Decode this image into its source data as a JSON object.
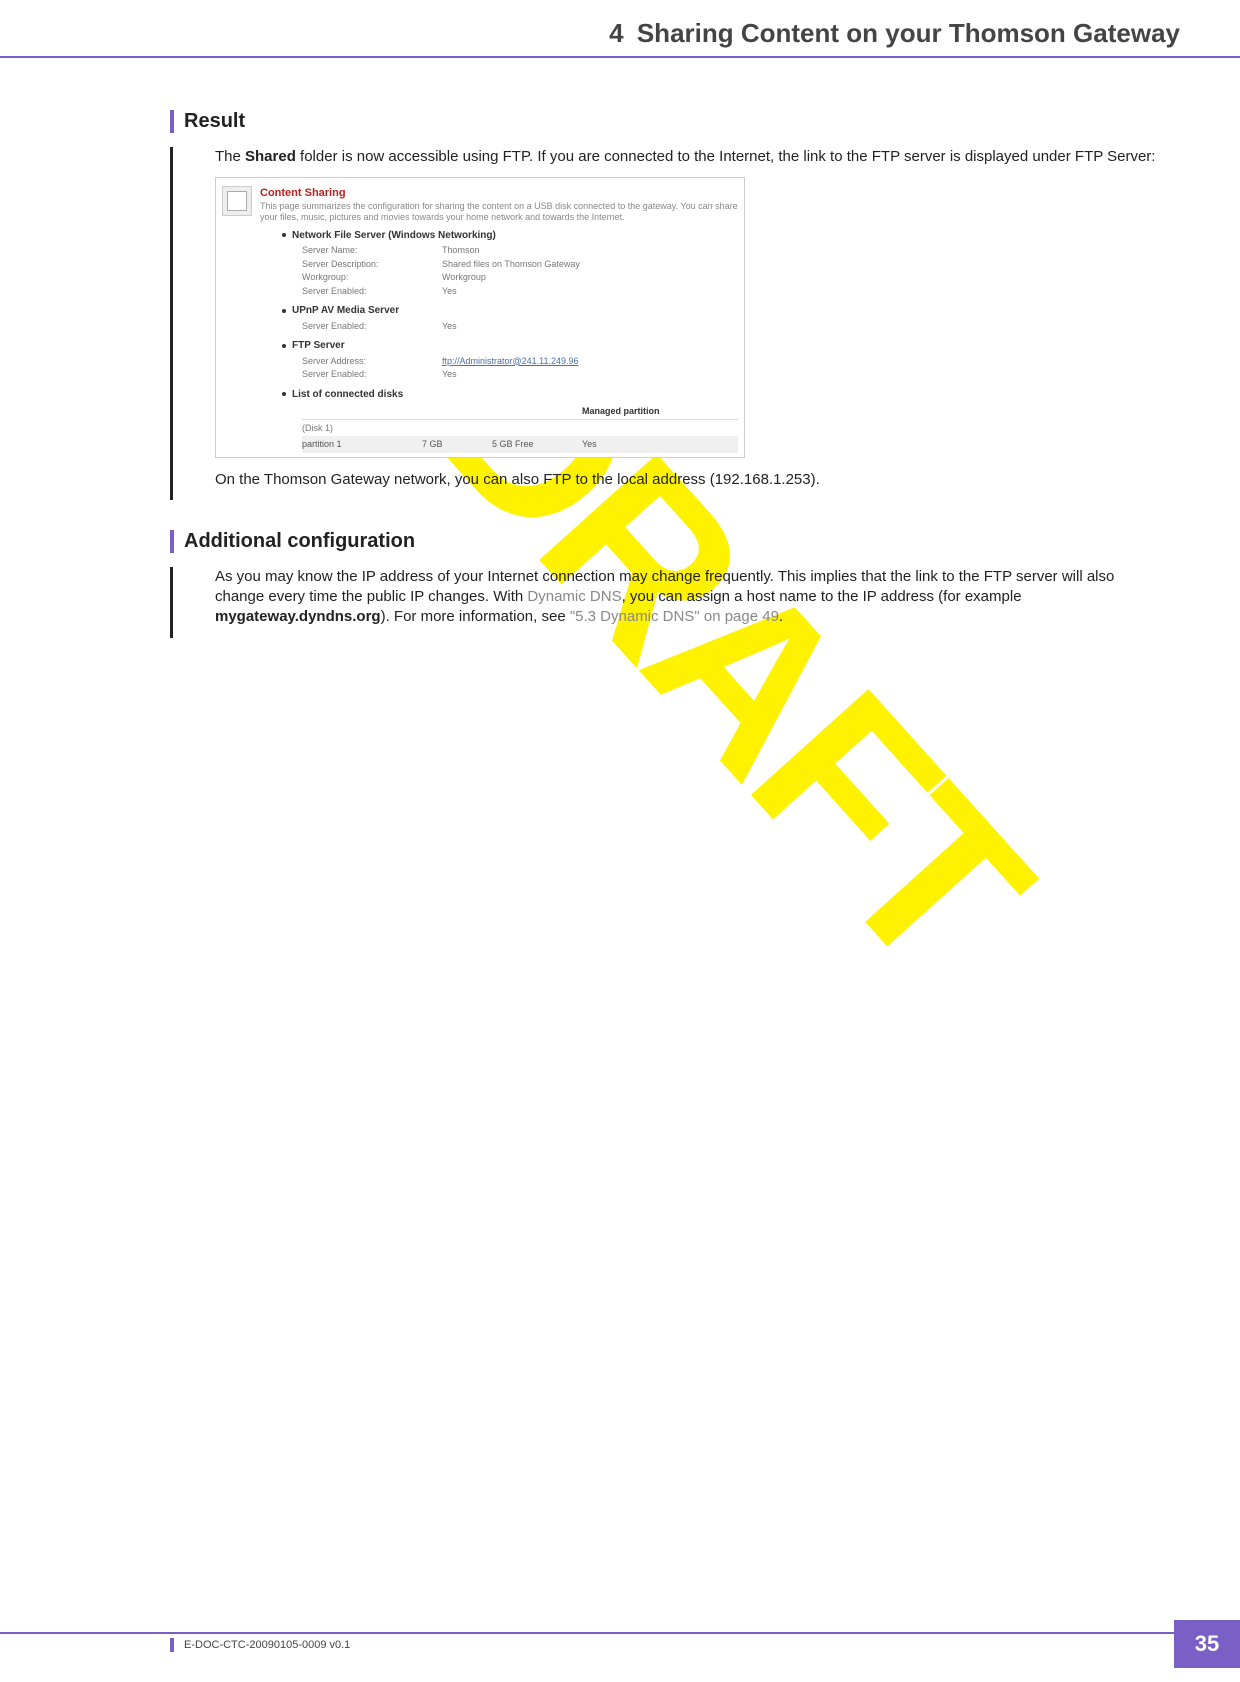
{
  "header": {
    "chapter_number": "4",
    "chapter_title": "Sharing Content on your Thomson Gateway"
  },
  "watermark": "DRAFT",
  "sections": {
    "result": {
      "title": "Result",
      "intro_pre": "The ",
      "intro_bold": "Shared",
      "intro_post": " folder is now accessible using FTP. If you are connected to the Internet, the link to the FTP server is displayed under FTP Server:",
      "outro": "On the Thomson Gateway network, you can also FTP to the local address (192.168.1.253)."
    },
    "additional": {
      "title": "Additional configuration",
      "p_pre": "As you may know the IP address of your Internet connection may change frequently. This implies that the link to the FTP server will also change every time the public IP changes. With ",
      "p_link1": "Dynamic DNS",
      "p_mid1": ", you can assign a host name to the IP address (for example ",
      "p_bold": "mygateway.dyndns.org",
      "p_mid2": "). For more information, see ",
      "p_link2": "\"5.3 Dynamic DNS\" on page 49",
      "p_end": "."
    }
  },
  "screenshot": {
    "title": "Content Sharing",
    "desc": "This page summarizes the configuration for sharing the content on a USB disk connected to the gateway. You can share your files, music, pictures and movies towards your home network and towards the Internet.",
    "nfs_title": "Network File Server (Windows Networking)",
    "nfs": {
      "server_name_label": "Server Name:",
      "server_name": "Thomson",
      "server_desc_label": "Server Description:",
      "server_desc": "Shared files on Thomson Gateway",
      "workgroup_label": "Workgroup:",
      "workgroup": "Workgroup",
      "enabled_label": "Server Enabled:",
      "enabled": "Yes"
    },
    "upnp_title": "UPnP AV Media Server",
    "upnp": {
      "enabled_label": "Server Enabled:",
      "enabled": "Yes"
    },
    "ftp_title": "FTP Server",
    "ftp": {
      "addr_label": "Server Address:",
      "addr": "ftp://Administrator@241.11.249.96",
      "enabled_label": "Server Enabled:",
      "enabled": "Yes"
    },
    "disks_title": "List of connected disks",
    "table_head_managed": "Managed partition",
    "disk_label": "(Disk 1)",
    "partition": {
      "name": "partition 1",
      "size": "7 GB",
      "free": "5 GB Free",
      "managed": "Yes"
    }
  },
  "footer": {
    "doc_id": "E-DOC-CTC-20090105-0009 v0.1",
    "page": "35"
  }
}
